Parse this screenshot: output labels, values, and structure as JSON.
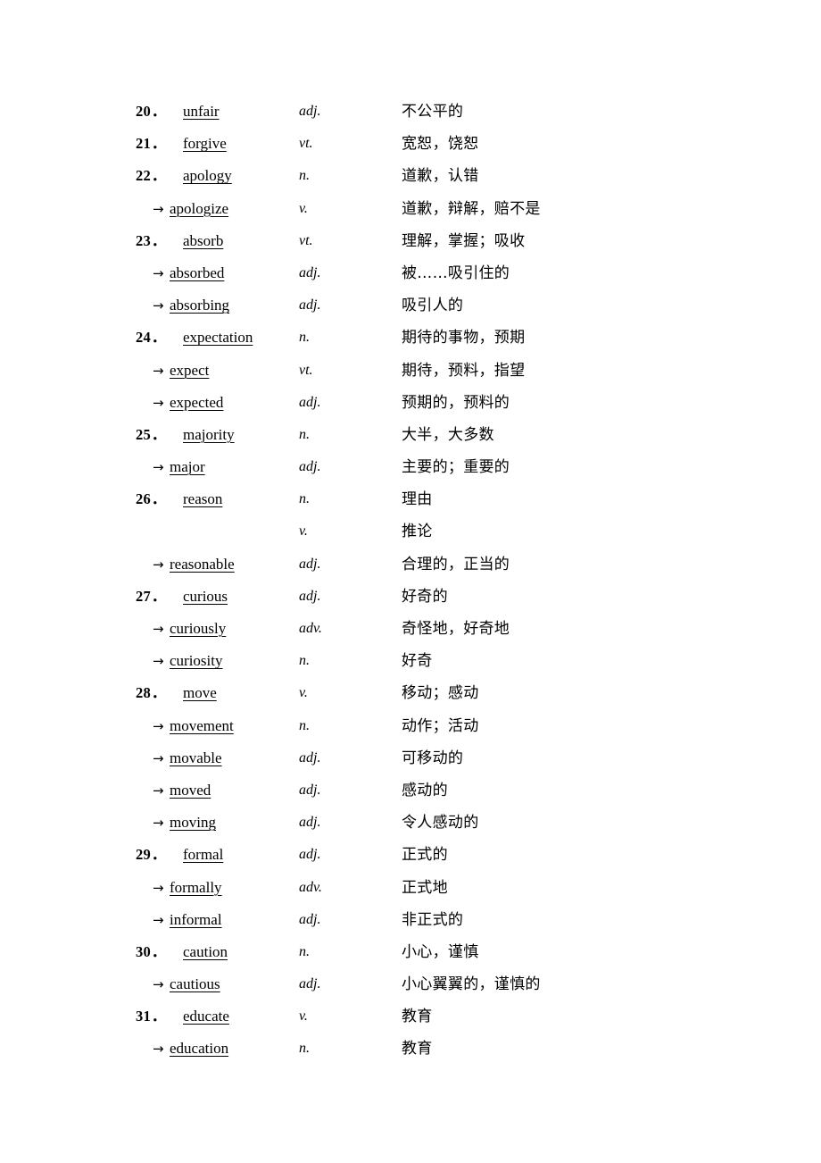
{
  "page": {
    "background_color": "#ffffff",
    "text_color": "#000000",
    "derived_marker": "→",
    "number_suffix": "．"
  },
  "entries": [
    {
      "kind": "main",
      "number": "20",
      "word": "unfair",
      "pos": "adj.",
      "gloss": "不公平的"
    },
    {
      "kind": "main",
      "number": "21",
      "word": "forgive",
      "pos": "vt.",
      "gloss": "宽恕，饶恕"
    },
    {
      "kind": "main",
      "number": "22",
      "word": "apology",
      "pos": "n.",
      "gloss": "道歉，认错"
    },
    {
      "kind": "deriv",
      "number": "",
      "word": "apologize",
      "pos": "v.",
      "gloss": "道歉，辩解，赔不是"
    },
    {
      "kind": "main",
      "number": "23",
      "word": "absorb",
      "pos": "vt.",
      "gloss": "理解，掌握；吸收"
    },
    {
      "kind": "deriv",
      "number": "",
      "word": "absorbed",
      "pos": "adj.",
      "gloss": "被……吸引住的"
    },
    {
      "kind": "deriv",
      "number": "",
      "word": "absorbing",
      "pos": "adj.",
      "gloss": "吸引人的"
    },
    {
      "kind": "main",
      "number": "24",
      "word": "expectation",
      "pos": "n.",
      "gloss": "期待的事物，预期"
    },
    {
      "kind": "deriv",
      "number": "",
      "word": "expect",
      "pos": "vt.",
      "gloss": "期待，预料，指望"
    },
    {
      "kind": "deriv",
      "number": "",
      "word": "expected",
      "pos": "adj.",
      "gloss": "预期的，预料的"
    },
    {
      "kind": "main",
      "number": "25",
      "word": "majority",
      "pos": "n.",
      "gloss": "大半，大多数"
    },
    {
      "kind": "deriv",
      "number": "",
      "word": "major",
      "pos": "adj.",
      "gloss": "主要的；重要的"
    },
    {
      "kind": "main",
      "number": "26",
      "word": "reason",
      "pos": "n.",
      "gloss": "理由"
    },
    {
      "kind": "cont",
      "number": "",
      "word": "",
      "pos": "v.",
      "gloss": "推论"
    },
    {
      "kind": "deriv",
      "number": "",
      "word": "reasonable",
      "pos": "adj.",
      "gloss": "合理的，正当的"
    },
    {
      "kind": "main",
      "number": "27",
      "word": "curious",
      "pos": "adj.",
      "gloss": "好奇的"
    },
    {
      "kind": "deriv",
      "number": "",
      "word": "curiously",
      "pos": "adv.",
      "gloss": "奇怪地，好奇地"
    },
    {
      "kind": "deriv",
      "number": "",
      "word": "curiosity",
      "pos": "n.",
      "gloss": "好奇"
    },
    {
      "kind": "main",
      "number": "28",
      "word": "move",
      "pos": "v.",
      "gloss": "移动；感动"
    },
    {
      "kind": "deriv",
      "number": "",
      "word": "movement",
      "pos": "n.",
      "gloss": "动作；活动"
    },
    {
      "kind": "deriv",
      "number": "",
      "word": "movable",
      "pos": "adj.",
      "gloss": "可移动的"
    },
    {
      "kind": "deriv",
      "number": "",
      "word": "moved",
      "pos": "adj.",
      "gloss": "感动的"
    },
    {
      "kind": "deriv",
      "number": "",
      "word": "moving",
      "pos": "adj.",
      "gloss": "令人感动的"
    },
    {
      "kind": "main",
      "number": "29",
      "word": "formal",
      "pos": "adj.",
      "gloss": "正式的"
    },
    {
      "kind": "deriv",
      "number": "",
      "word": "formally",
      "pos": "adv.",
      "gloss": "正式地"
    },
    {
      "kind": "deriv",
      "number": "",
      "word": "informal",
      "pos": "adj.",
      "gloss": "非正式的"
    },
    {
      "kind": "main",
      "number": "30",
      "word": "caution",
      "pos": "n.",
      "gloss": "小心，谨慎"
    },
    {
      "kind": "deriv",
      "number": "",
      "word": "cautious",
      "pos": "adj.",
      "gloss": "小心翼翼的，谨慎的"
    },
    {
      "kind": "main",
      "number": "31",
      "word": "educate",
      "pos": "v.",
      "gloss": "教育"
    },
    {
      "kind": "deriv",
      "number": "",
      "word": "education",
      "pos": "n.",
      "gloss": "教育"
    }
  ]
}
